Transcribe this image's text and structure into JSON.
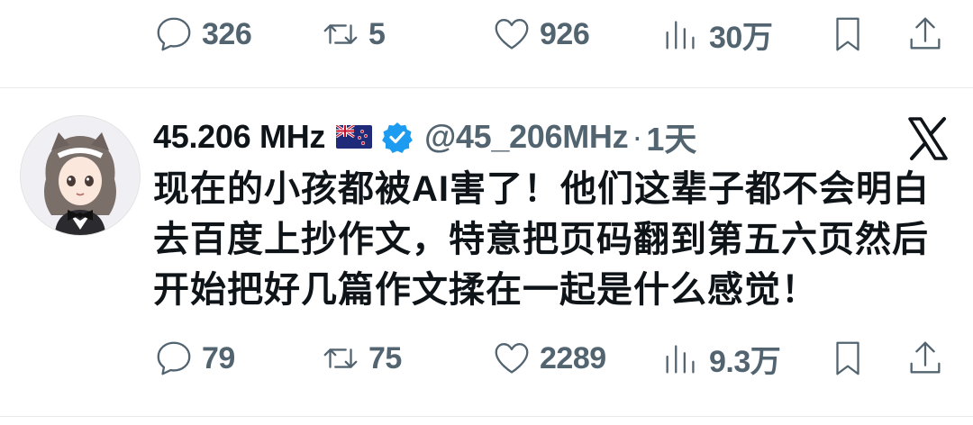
{
  "top_actions": {
    "reply_count": "326",
    "repost_count": "5",
    "like_count": "926",
    "view_count": "30万"
  },
  "tweet": {
    "display_name": "45.206 MHz",
    "handle": "@45_206MHz",
    "separator": "·",
    "time": "1天",
    "text_lines": [
      "现在的小孩都被AI害了！他们这辈子都不会明白",
      "去百度上抄作文，特意把页码翻到第五六页然后",
      "开始把好几篇作文揉在一起是什么感觉！"
    ],
    "actions": {
      "reply_count": "79",
      "repost_count": "75",
      "like_count": "2289",
      "view_count": "9.3万"
    }
  },
  "icons": {
    "reply": "reply-icon",
    "repost": "repost-icon",
    "like": "like-icon",
    "views": "views-icon",
    "bookmark": "bookmark-icon",
    "share": "share-icon",
    "flag": "new-zealand-flag-icon",
    "verified": "verified-badge-icon",
    "platform": "x-logo-icon"
  },
  "colors": {
    "text_primary": "#0f1419",
    "text_secondary": "#536471",
    "verified": "#1d9bf0",
    "divider": "#e7e9ea"
  }
}
